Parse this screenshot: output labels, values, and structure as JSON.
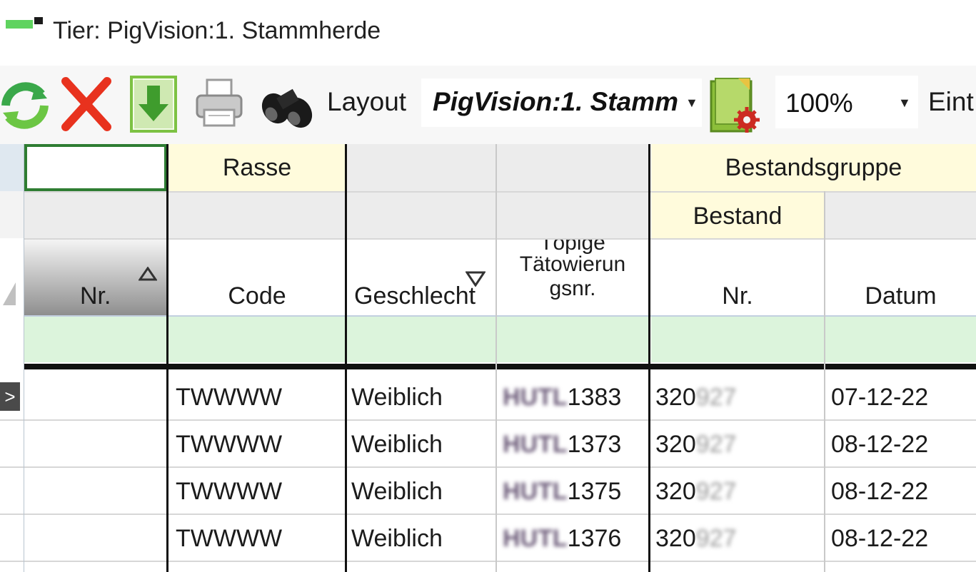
{
  "window": {
    "title": "Tier: PigVision:1. Stammherde"
  },
  "toolbar": {
    "icons": [
      "refresh-icon",
      "delete-icon",
      "download-icon",
      "print-icon",
      "binoculars-icon",
      "layout-settings-icon"
    ],
    "layout_label": "Layout",
    "layout_value": "PigVision:1. Stamm",
    "zoom_value": "100%",
    "truncated_label": "Eint"
  },
  "grid": {
    "group_headers": {
      "rasse": "Rasse",
      "bestandsgruppe": "Bestandsgruppe",
      "bestand": "Bestand"
    },
    "columns": {
      "nr": "Nr.",
      "code": "Code",
      "geschlecht": "Geschlecht",
      "taetowierung_top": "Töpige",
      "taetowierung_1": "Tätowierun",
      "taetowierung_2": "gsnr.",
      "bestand_nr": "Nr.",
      "datum": "Datum"
    },
    "rows": [
      {
        "code": "TWWWW",
        "geschlecht": "Weiblich",
        "tat_prefix": "HUTL",
        "tat_num": "1383",
        "nr_prefix": "320",
        "nr_hidden": "927",
        "datum": "07-12-22",
        "current": true
      },
      {
        "code": "TWWWW",
        "geschlecht": "Weiblich",
        "tat_prefix": "HUTL",
        "tat_num": "1373",
        "nr_prefix": "320",
        "nr_hidden": "927",
        "datum": "08-12-22",
        "current": false
      },
      {
        "code": "TWWWW",
        "geschlecht": "Weiblich",
        "tat_prefix": "HUTL",
        "tat_num": "1375",
        "nr_prefix": "320",
        "nr_hidden": "927",
        "datum": "08-12-22",
        "current": false
      },
      {
        "code": "TWWWW",
        "geschlecht": "Weiblich",
        "tat_prefix": "HUTL",
        "tat_num": "1376",
        "nr_prefix": "320",
        "nr_hidden": "927",
        "datum": "08-12-22",
        "current": false
      }
    ],
    "colors": {
      "header_yellow": "#fffbdc",
      "filter_green": "#dcf4dc",
      "selection_border": "#2e7d32"
    }
  }
}
